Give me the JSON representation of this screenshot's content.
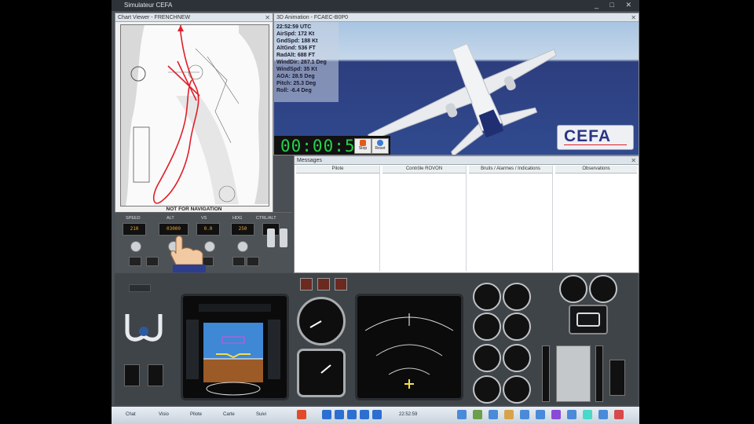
{
  "window": {
    "title": "Simulateur CEFA"
  },
  "chart_viewer": {
    "title": "Chart Viewer - FRENCHNEW",
    "footer": "NOT FOR NAVIGATION"
  },
  "animation": {
    "title": "3D Animation - FCAEC-B0P0",
    "telemetry": [
      "22:52:59 UTC",
      "AirSpd: 172 Kt",
      "GndSpd: 188 Kt",
      "AltGnd: 536 FT",
      "RadAlt: 688 FT",
      "WindDir: 287.1 Deg",
      "WindSpd: 35 Kt",
      "AOA: 28.5 Deg",
      "Pitch: 25.3 Deg",
      "Roll: -6.4 Deg"
    ],
    "timer": "00:00:56",
    "stop_label": "Stop",
    "reset_label": "Reset",
    "logo": "CEFA"
  },
  "messages": {
    "title": "Messages",
    "columns": [
      "Pilote",
      "Contrôle ROVON",
      "Bruits / Alarmes / Indications",
      "Observations"
    ]
  },
  "autopilot": {
    "labels": [
      "SPEED",
      "ALT",
      "VS",
      "HDG",
      "CTRL/ALT"
    ],
    "readouts": [
      "210",
      "03000",
      "0.0",
      "250",
      ""
    ]
  },
  "taskbar": {
    "start": "",
    "items": [
      "Chat",
      "Visio",
      "Pilote",
      "Carte",
      "Suivi"
    ],
    "clock": "22:52:59"
  },
  "colors": {
    "timer": "#26d14a",
    "logo": "#2b3585",
    "route": "#e0202a",
    "sky": "#c5d7ea",
    "ocean": "#304a8f"
  }
}
